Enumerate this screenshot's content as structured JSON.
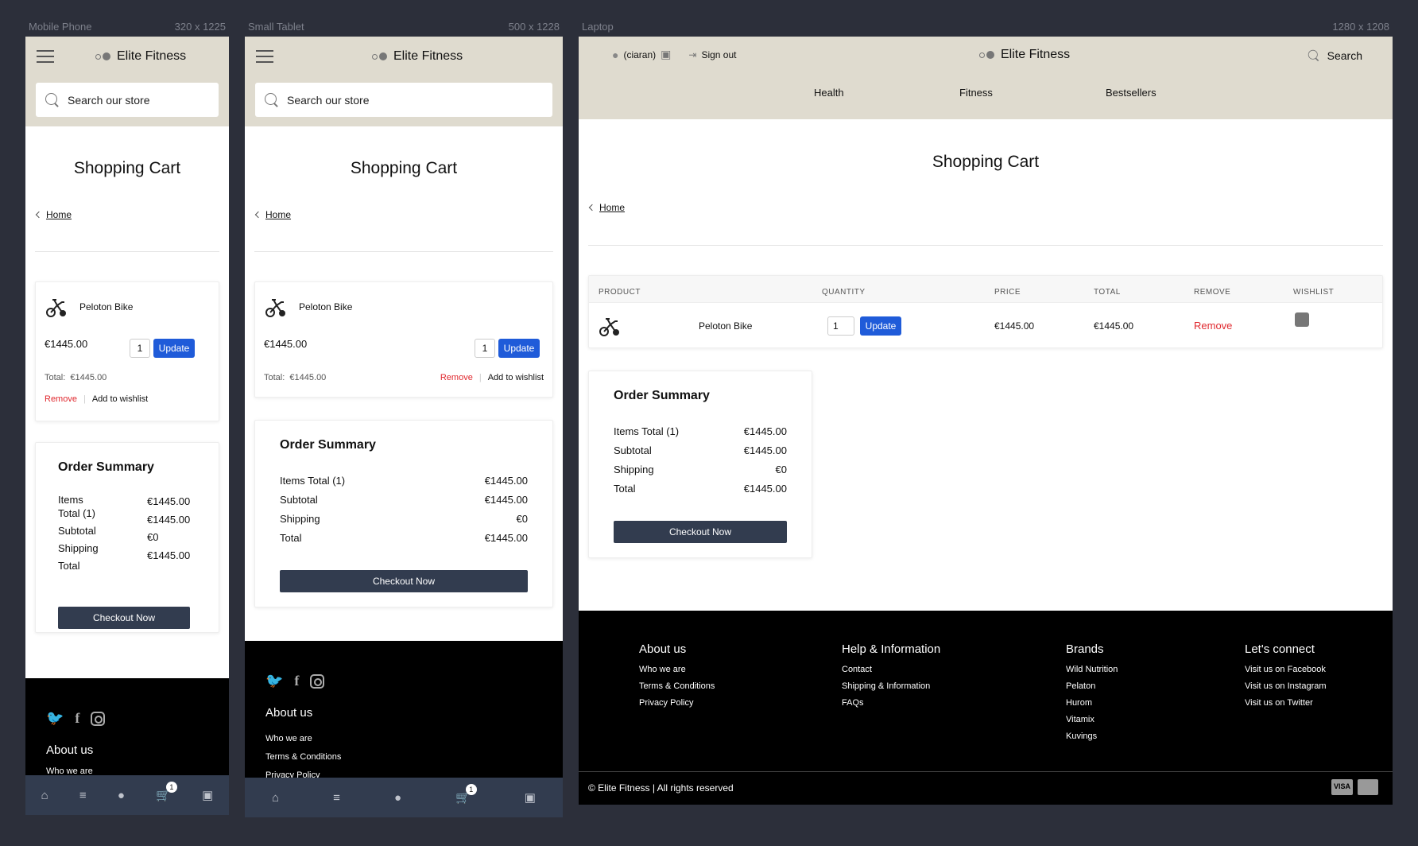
{
  "frames": {
    "mobile": {
      "label": "Mobile Phone",
      "size": "320 x 1225"
    },
    "tablet": {
      "label": "Small Tablet",
      "size": "500 x 1228"
    },
    "laptop": {
      "label": "Laptop",
      "size": "1280 x 1208"
    }
  },
  "brand": "Elite Fitness",
  "search_placeholder": "Search our store",
  "page_title": "Shopping Cart",
  "breadcrumb_home": "Home",
  "product": {
    "name": "Peloton Bike",
    "price": "€1445.00",
    "quantity": "1",
    "total_label": "Total:",
    "total": "€1445.00"
  },
  "buttons": {
    "update": "Update",
    "remove": "Remove",
    "wishlist": "Add to wishlist",
    "checkout": "Checkout Now"
  },
  "order_summary": {
    "title": "Order Summary",
    "items_total_label": "Items Total (1)",
    "items_label": "Items",
    "total1_label": "Total (1)",
    "items_total": "€1445.00",
    "subtotal_label": "Subtotal",
    "subtotal": "€1445.00",
    "shipping_label": "Shipping",
    "shipping": "€0",
    "total_label": "Total",
    "total": "€1445.00"
  },
  "header_laptop": {
    "user": "(ciaran)",
    "sign_out": "Sign out",
    "search": "Search",
    "nav": [
      "Health",
      "Fitness",
      "Bestsellers"
    ]
  },
  "table_headers": [
    "PRODUCT",
    "QUANTITY",
    "PRICE",
    "TOTAL",
    "REMOVE",
    "WISHLIST"
  ],
  "footer": {
    "about": {
      "title": "About us",
      "links": [
        "Who we are",
        "Terms & Conditions",
        "Privacy Policy"
      ]
    },
    "help": {
      "title": "Help & Information",
      "links": [
        "Contact",
        "Shipping & Information",
        "FAQs"
      ]
    },
    "brands": {
      "title": "Brands",
      "links": [
        "Wild Nutrition",
        "Pelaton",
        "Hurom",
        "Vitamix",
        "Kuvings"
      ]
    },
    "connect": {
      "title": "Let's connect",
      "links": [
        "Visit us on Facebook",
        "Visit us on Instagram",
        "Visit us on Twitter"
      ]
    },
    "copyright": "© Elite Fitness | All rights reserved",
    "mobile_peek": "Who we are",
    "cart_count": "1",
    "payment": [
      "VISA",
      "mastercard"
    ]
  },
  "icons": [
    "hamburger-icon",
    "search-icon",
    "bike-image",
    "twitter-icon",
    "facebook-icon",
    "instagram-icon",
    "home-icon",
    "search-nav-icon",
    "user-icon",
    "cart-icon",
    "bag-icon",
    "wishlist-bag-icon",
    "sign-out-icon"
  ],
  "colors": {
    "header": "#dfdbcf",
    "update": "#1f5bd9",
    "remove": "#e0282e",
    "checkout": "#323c4f",
    "bottom_nav": "#323c4f",
    "background": "#2c2f3a"
  }
}
